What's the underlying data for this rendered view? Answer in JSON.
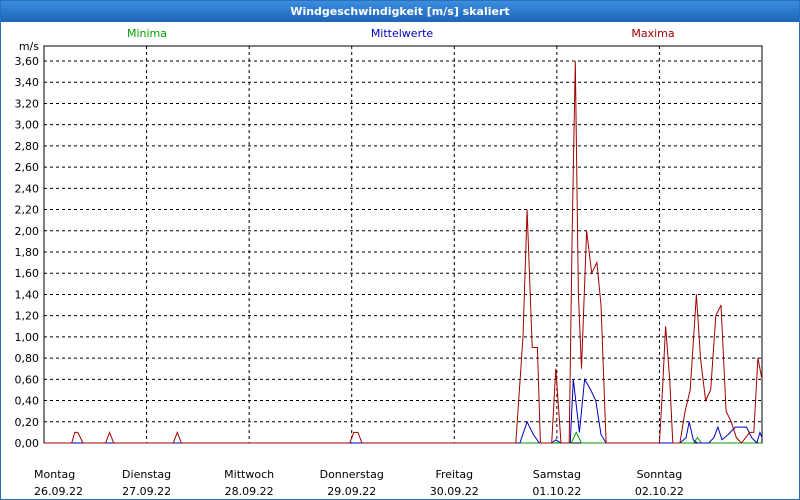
{
  "window": {
    "title": "Windgeschwindigkeit [m/s] skaliert"
  },
  "chart_data": {
    "type": "line",
    "title": "Windgeschwindigkeit [m/s] skaliert",
    "ylabel": "m/s",
    "ylim": [
      0,
      3.6
    ],
    "yticks": [
      "0,00",
      "0,20",
      "0,40",
      "0,60",
      "0,80",
      "1,00",
      "1,20",
      "1,40",
      "1,60",
      "1,80",
      "2,00",
      "2,20",
      "2,40",
      "2,60",
      "2,80",
      "3,00",
      "3,20",
      "3,40",
      "3,60"
    ],
    "xlim": [
      0,
      7
    ],
    "days": [
      {
        "weekday": "Montag",
        "date": "26.09.22"
      },
      {
        "weekday": "Dienstag",
        "date": "27.09.22"
      },
      {
        "weekday": "Mittwoch",
        "date": "28.09.22"
      },
      {
        "weekday": "Donnerstag",
        "date": "29.09.22"
      },
      {
        "weekday": "Freitag",
        "date": "30.09.22"
      },
      {
        "weekday": "Samstag",
        "date": "01.10.22"
      },
      {
        "weekday": "Sonntag",
        "date": "02.10.22"
      }
    ],
    "grid": true,
    "legend_position": "top",
    "series": [
      {
        "name": "Minima",
        "color": "#00a000",
        "points": [
          [
            0,
            0
          ],
          [
            5.14,
            0
          ],
          [
            5.19,
            0.1
          ],
          [
            5.24,
            0
          ],
          [
            6.33,
            0
          ],
          [
            6.37,
            0.05
          ],
          [
            6.41,
            0
          ],
          [
            7,
            0
          ]
        ]
      },
      {
        "name": "Mittelwerte",
        "color": "#0000c0",
        "points": [
          [
            0,
            0
          ],
          [
            4.64,
            0
          ],
          [
            4.71,
            0.2
          ],
          [
            4.77,
            0.08
          ],
          [
            4.83,
            0
          ],
          [
            4.95,
            0
          ],
          [
            4.99,
            0.03
          ],
          [
            5.04,
            0
          ],
          [
            5.13,
            0
          ],
          [
            5.16,
            0.6
          ],
          [
            5.22,
            0.1
          ],
          [
            5.27,
            0.6
          ],
          [
            5.33,
            0.5
          ],
          [
            5.38,
            0.4
          ],
          [
            5.43,
            0.08
          ],
          [
            5.48,
            0
          ],
          [
            6.2,
            0
          ],
          [
            6.26,
            0.05
          ],
          [
            6.29,
            0.2
          ],
          [
            6.33,
            0.03
          ],
          [
            6.37,
            0
          ],
          [
            6.48,
            0
          ],
          [
            6.53,
            0.05
          ],
          [
            6.57,
            0.15
          ],
          [
            6.61,
            0.03
          ],
          [
            6.67,
            0.08
          ],
          [
            6.74,
            0.15
          ],
          [
            6.85,
            0.15
          ],
          [
            6.9,
            0.05
          ],
          [
            6.95,
            0
          ],
          [
            6.98,
            0.1
          ],
          [
            7,
            0.05
          ]
        ]
      },
      {
        "name": "Maxima",
        "color": "#a00000",
        "points": [
          [
            0,
            0
          ],
          [
            0.27,
            0
          ],
          [
            0.3,
            0.1
          ],
          [
            0.33,
            0.1
          ],
          [
            0.38,
            0
          ],
          [
            0.6,
            0
          ],
          [
            0.64,
            0.1
          ],
          [
            0.68,
            0
          ],
          [
            1.26,
            0
          ],
          [
            1.3,
            0.1
          ],
          [
            1.34,
            0
          ],
          [
            2.98,
            0
          ],
          [
            3.02,
            0.1
          ],
          [
            3.06,
            0.1
          ],
          [
            3.1,
            0
          ],
          [
            4.6,
            0
          ],
          [
            4.67,
            1.0
          ],
          [
            4.71,
            2.2
          ],
          [
            4.76,
            0.9
          ],
          [
            4.81,
            0.9
          ],
          [
            4.84,
            0
          ],
          [
            4.95,
            0
          ],
          [
            4.99,
            0.7
          ],
          [
            5.04,
            0
          ],
          [
            5.12,
            0
          ],
          [
            5.15,
            2.0
          ],
          [
            5.18,
            3.6
          ],
          [
            5.21,
            1.4
          ],
          [
            5.24,
            0.7
          ],
          [
            5.29,
            2.0
          ],
          [
            5.34,
            1.6
          ],
          [
            5.39,
            1.7
          ],
          [
            5.43,
            1.3
          ],
          [
            5.48,
            0
          ],
          [
            6.0,
            0
          ],
          [
            6.03,
            0.5
          ],
          [
            6.06,
            1.1
          ],
          [
            6.1,
            0.6
          ],
          [
            6.13,
            0
          ],
          [
            6.2,
            0
          ],
          [
            6.25,
            0.3
          ],
          [
            6.3,
            0.5
          ],
          [
            6.36,
            1.4
          ],
          [
            6.4,
            0.8
          ],
          [
            6.45,
            0.4
          ],
          [
            6.5,
            0.5
          ],
          [
            6.55,
            1.2
          ],
          [
            6.6,
            1.3
          ],
          [
            6.65,
            0.3
          ],
          [
            6.7,
            0.2
          ],
          [
            6.75,
            0.05
          ],
          [
            6.8,
            0
          ],
          [
            6.88,
            0.1
          ],
          [
            6.92,
            0.1
          ],
          [
            6.96,
            0.8
          ],
          [
            7,
            0.6
          ]
        ]
      }
    ]
  }
}
